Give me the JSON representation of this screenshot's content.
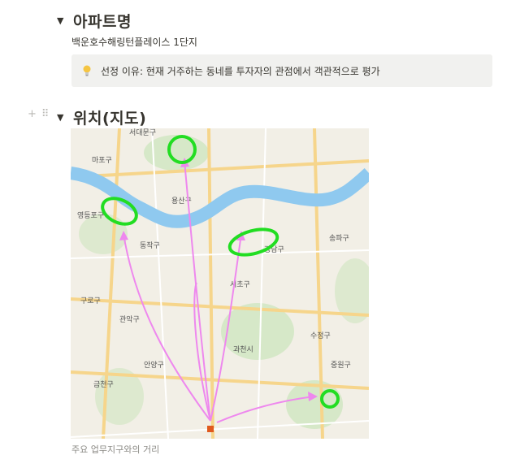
{
  "section1": {
    "title": "아파트명",
    "subtitle": "백운호수해링턴플레이스 1단지"
  },
  "callout": {
    "icon": "lightbulb-icon",
    "text": "선정 이유: 현재 거주하는 동네를 투자자의 관점에서 객관적으로 평가"
  },
  "section2": {
    "title": "위치(지도)"
  },
  "map": {
    "labels": {
      "mapo": "마포구",
      "seodaemun": "서대문구",
      "yongsan": "용산구",
      "yeongdeungpo": "영등포구",
      "dongjak": "동작구",
      "gangnam": "강남구",
      "seocho": "서초구",
      "songpa": "송파구",
      "gwanak": "관악구",
      "geumcheon": "금천구",
      "anyang": "안양구",
      "gwacheon": "과천시",
      "sujeong": "수정구",
      "jungwon": "중원구",
      "guro": "구로구"
    },
    "colors": {
      "river": "#8fc9ef",
      "highlight": "#22dd22",
      "arrow": "#ee88ee",
      "home": "#e05a1e"
    }
  },
  "caption": "주요 업무지구와의 거리"
}
